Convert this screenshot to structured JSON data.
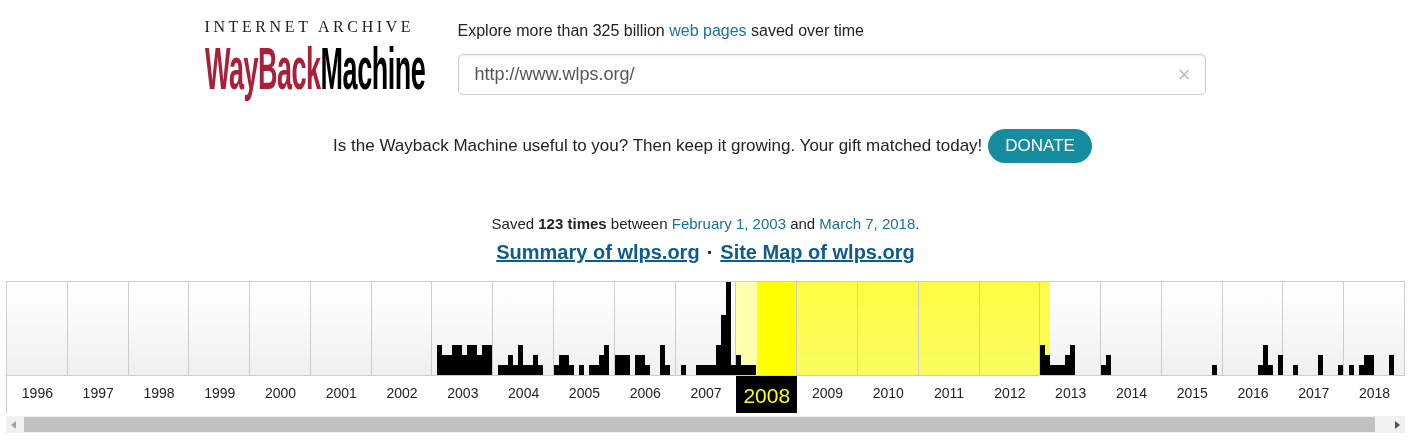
{
  "logo": {
    "top": "INTERNET ARCHIVE",
    "word_1": "WayBack",
    "word_2": "Machine"
  },
  "tagline": {
    "before": "Explore more than 325 billion",
    "link": "web pages",
    "after": "saved over time"
  },
  "search": {
    "value": "http://www.wlps.org/",
    "clear": "×"
  },
  "donate": {
    "text": "Is the Wayback Machine useful to you? Then keep it growing. Your gift matched today!",
    "button": "DONATE"
  },
  "saved": {
    "prefix": "Saved **123 times** between",
    "first_link": "February 1, 2003",
    "middle": "and",
    "last_link": "March 7, 2018",
    "suffix": "."
  },
  "summary_links": [
    {
      "label": "Summary of wlps.org"
    },
    {
      "label": "Site Map of wlps.org"
    }
  ],
  "separator": "·",
  "years": [
    {
      "label": "1996",
      "selected": false
    },
    {
      "label": "1997",
      "selected": false
    },
    {
      "label": "1998",
      "selected": false
    },
    {
      "label": "1999",
      "selected": false
    },
    {
      "label": "2000",
      "selected": false
    },
    {
      "label": "2001",
      "selected": false
    },
    {
      "label": "2002",
      "selected": false
    },
    {
      "label": "2003",
      "selected": false
    },
    {
      "label": "2004",
      "selected": false
    },
    {
      "label": "2005",
      "selected": false
    },
    {
      "label": "2006",
      "selected": false
    },
    {
      "label": "2007",
      "selected": false
    },
    {
      "label": "2008",
      "selected": true
    },
    {
      "label": "2009",
      "selected": false
    },
    {
      "label": "2010",
      "selected": false
    },
    {
      "label": "2011",
      "selected": false
    },
    {
      "label": "2012",
      "selected": false
    },
    {
      "label": "2013",
      "selected": false
    },
    {
      "label": "2014",
      "selected": false
    },
    {
      "label": "2015",
      "selected": false
    },
    {
      "label": "2016",
      "selected": false
    },
    {
      "label": "2017",
      "selected": false
    },
    {
      "label": "2018",
      "selected": false
    }
  ]
}
